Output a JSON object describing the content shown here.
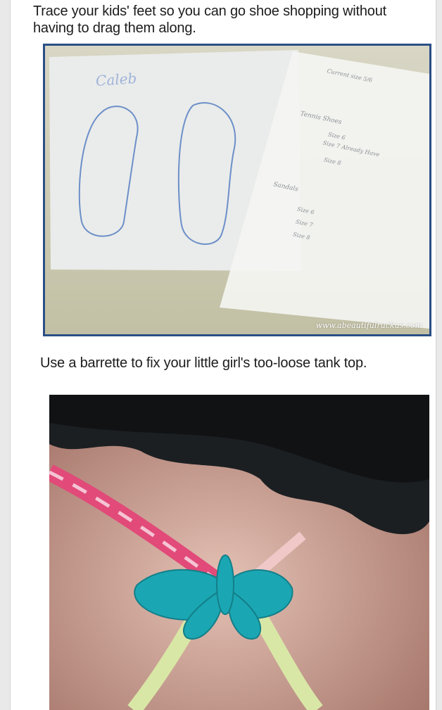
{
  "tips": [
    {
      "caption": "Trace your kids' feet so you can go shoe shopping without having to drag them along.",
      "photo": {
        "subject": "paper with traced feet outlines and handwritten shoe-size notes",
        "handwriting": {
          "name": "Caleb",
          "notes": [
            "Current size 5/6",
            "Tennis Shoes",
            "Size 6",
            "Size 7 Already Have",
            "Size 8",
            "Sandals",
            "Size 6",
            "Size 7",
            "Size 8"
          ]
        },
        "watermark": "www.abeautifulruckus.com",
        "frame_color": "#2a4f86"
      }
    },
    {
      "caption": "Use a barrette to fix your little girl's too-loose tank top.",
      "photo": {
        "subject": "child's back with tank-top straps clipped together by a teal butterfly barrette",
        "barrette_color": "#1aa7b3"
      }
    }
  ]
}
